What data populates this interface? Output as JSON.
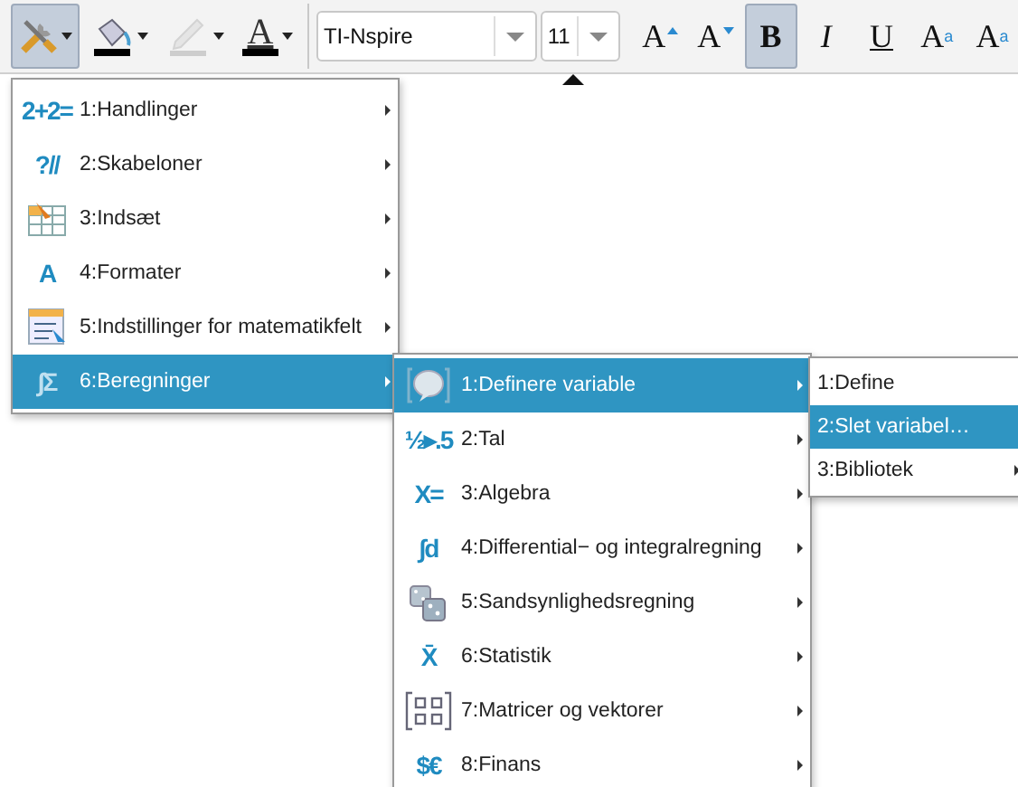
{
  "toolbar": {
    "tools": [
      {
        "kind": "tools",
        "selected": true,
        "disabled": false
      },
      {
        "kind": "fill",
        "selected": false,
        "disabled": false
      },
      {
        "kind": "line",
        "selected": false,
        "disabled": true
      },
      {
        "kind": "text_color",
        "label": "A",
        "selected": false,
        "disabled": false
      }
    ],
    "font_field": {
      "value": "TI-Nspire"
    },
    "size_field": {
      "value": "11"
    },
    "format_buttons": [
      {
        "kind": "grow",
        "label": "A",
        "selected": false
      },
      {
        "kind": "shrink",
        "label": "A",
        "selected": false
      },
      {
        "kind": "bold",
        "label": "B",
        "selected": true
      },
      {
        "kind": "italic",
        "label": "I",
        "selected": false
      },
      {
        "kind": "underline",
        "label": "U",
        "selected": false
      },
      {
        "kind": "superscript",
        "label": "A",
        "mark": "a",
        "selected": false
      },
      {
        "kind": "subscript",
        "label": "A",
        "mark": "a",
        "selected": false
      }
    ]
  },
  "menus": [
    {
      "items": [
        {
          "glyph": "2+2=",
          "label": "1:Handlinger",
          "submenu": true,
          "selected": false
        },
        {
          "glyph": "?//",
          "label": "2:Skabeloner",
          "submenu": true,
          "selected": false
        },
        {
          "label": "3:Indsæt",
          "submenu": true,
          "selected": false
        },
        {
          "glyph": "A",
          "label": "4:Formater",
          "submenu": true,
          "selected": false
        },
        {
          "label": "5:Indstillinger for matematikfelt",
          "submenu": true,
          "selected": false
        },
        {
          "glyph": "∫Σ",
          "label": "6:Beregninger",
          "submenu": true,
          "selected": true
        }
      ]
    },
    {
      "items": [
        {
          "label": "1:Definere variable",
          "submenu": true,
          "selected": true
        },
        {
          "glyph": "½▸.5",
          "label": "2:Tal",
          "submenu": true,
          "selected": false
        },
        {
          "glyph": "X=",
          "label": "3:Algebra",
          "submenu": true,
          "selected": false
        },
        {
          "glyph": "∫d",
          "label": "4:Differential− og integralregning",
          "submenu": true,
          "selected": false
        },
        {
          "label": "5:Sandsynlighedsregning",
          "submenu": true,
          "selected": false
        },
        {
          "glyph": "X̄",
          "label": "6:Statistik",
          "submenu": true,
          "selected": false
        },
        {
          "label": "7:Matricer og vektorer",
          "submenu": true,
          "selected": false
        },
        {
          "glyph": "$€",
          "label": "8:Finans",
          "submenu": true,
          "selected": false
        }
      ]
    },
    {
      "items": [
        {
          "label": "1:Define",
          "submenu": false,
          "selected": false
        },
        {
          "label": "2:Slet variabel…",
          "submenu": false,
          "selected": true
        },
        {
          "label": "3:Bibliotek",
          "submenu": true,
          "selected": false
        }
      ]
    }
  ]
}
